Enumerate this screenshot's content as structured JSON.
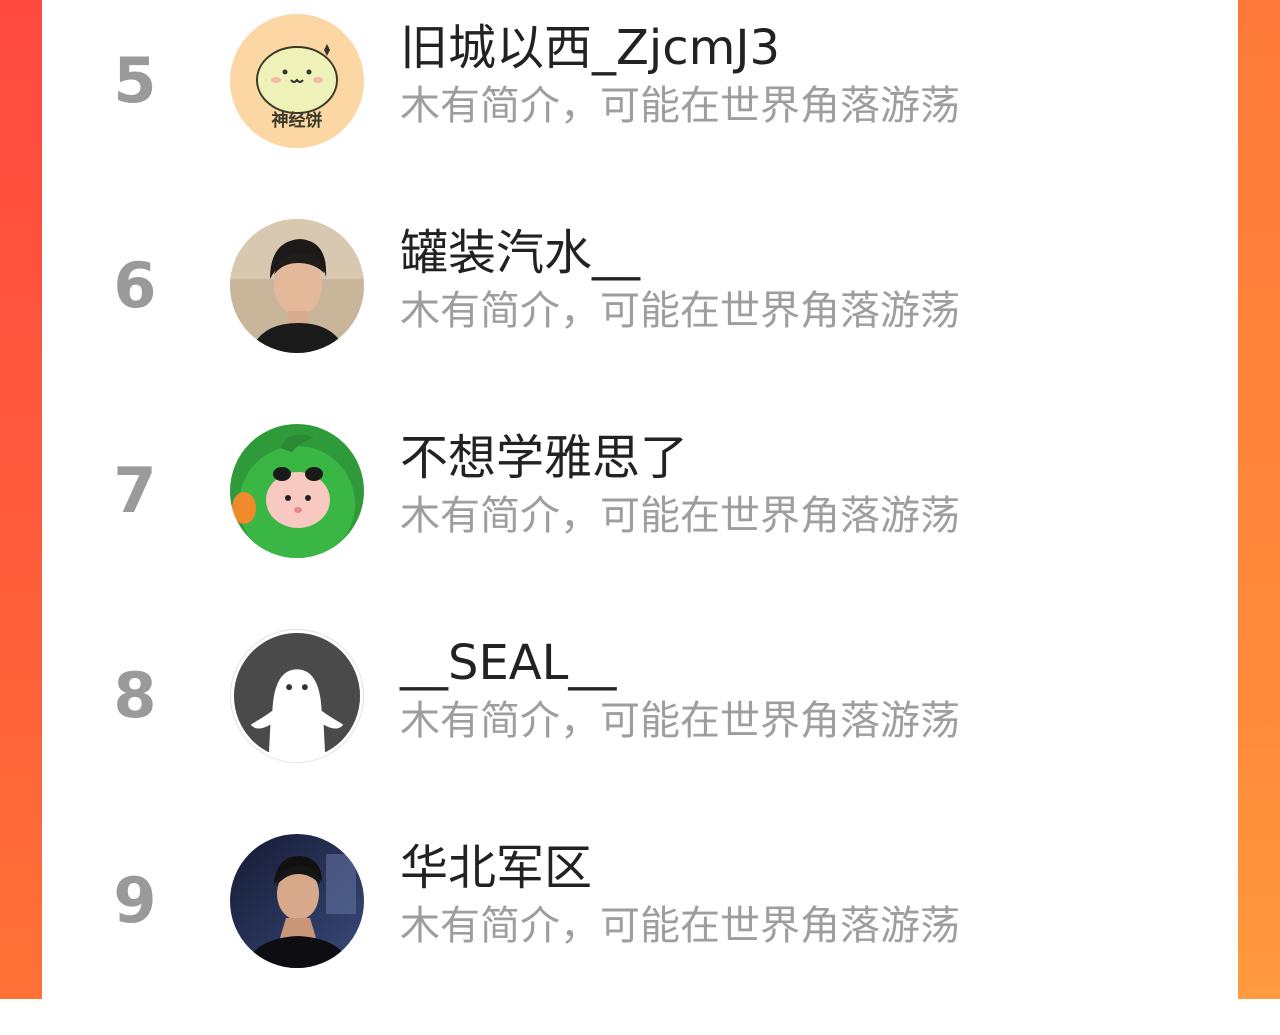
{
  "leaderboard": {
    "items": [
      {
        "rank": "5",
        "name": "旧城以西_ZjcmJ3",
        "bio": "木有简介，可能在世界角落游荡",
        "avatar": "cartoon-bun-avatar",
        "avatar_caption": "神经饼"
      },
      {
        "rank": "6",
        "name": "罐装汽水__",
        "bio": "木有简介，可能在世界角落游荡",
        "avatar": "man-portrait-avatar"
      },
      {
        "rank": "7",
        "name": "不想学雅思了",
        "bio": "木有简介，可能在世界角落游荡",
        "avatar": "green-cartoon-avatar"
      },
      {
        "rank": "8",
        "name": "__SEAL__",
        "bio": "木有简介，可能在世界角落游荡",
        "avatar": "default-ghost-avatar"
      },
      {
        "rank": "9",
        "name": "华北军区",
        "bio": "木有简介，可能在世界角落游荡",
        "avatar": "man-dark-portrait-avatar"
      }
    ]
  },
  "colors": {
    "background_left": "#ff4a40",
    "background_right": "#ff8a3a",
    "rank_text": "#9a9a9a",
    "name_text": "#222222",
    "bio_text": "#9e9e9e"
  }
}
